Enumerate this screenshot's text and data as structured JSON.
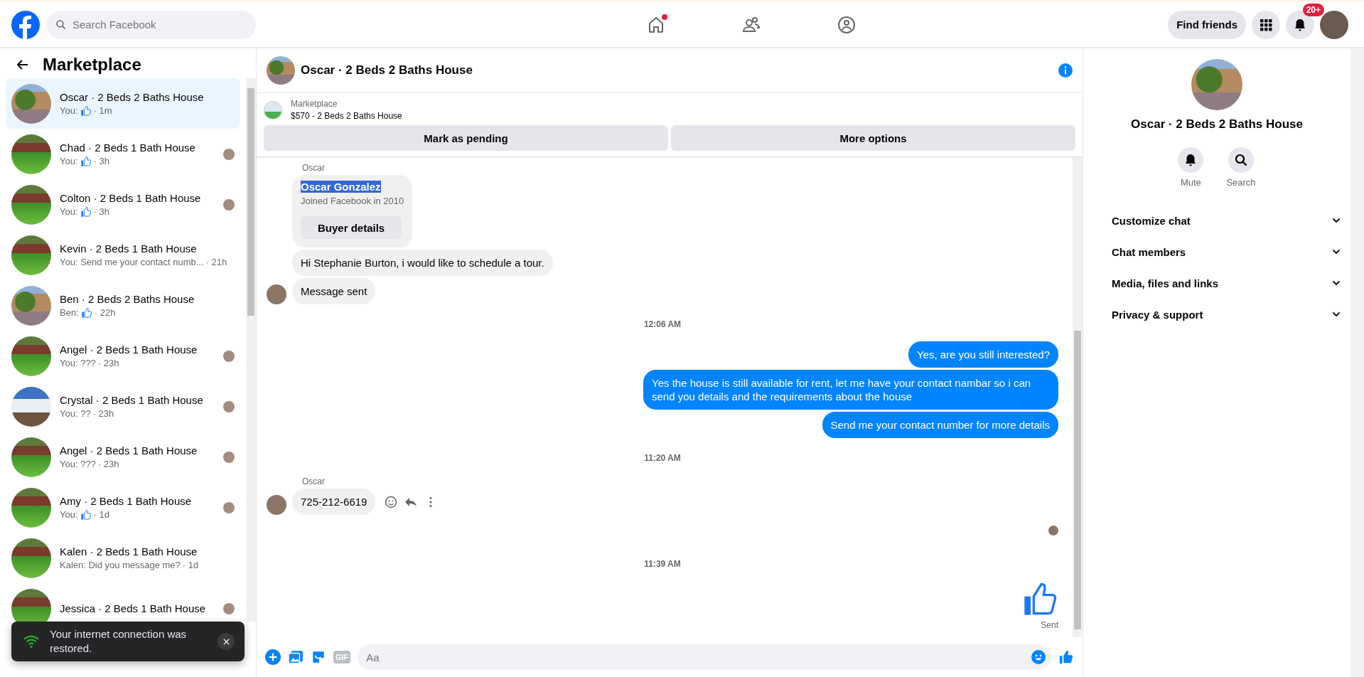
{
  "topbar": {
    "search": {
      "placeholder": "Search Facebook"
    },
    "nav": [
      {
        "kind": "home",
        "notification": true
      },
      {
        "kind": "friends",
        "notification": false
      },
      {
        "kind": "groups",
        "notification": false
      }
    ],
    "find_friends": "Find friends",
    "notifications_badge": "20+"
  },
  "sidebar": {
    "title": "Marketplace",
    "items": [
      {
        "title": "Oscar · 2 Beds 2 Baths House",
        "preview": "You:",
        "like": true,
        "time": "· 1m",
        "kind": "palm",
        "seen": false,
        "selected": true
      },
      {
        "title": "Chad · 2 Beds 1 Bath House",
        "preview": "You:",
        "like": true,
        "time": "· 3h",
        "kind": "lawn",
        "seen": true,
        "selected": false
      },
      {
        "title": "Colton · 2 Beds 1 Bath House",
        "preview": "You:",
        "like": true,
        "time": "· 3h",
        "kind": "lawn",
        "seen": true,
        "selected": false
      },
      {
        "title": "Kevin · 2 Beds 1 Bath House",
        "preview": "You: Send me your contact numb...",
        "like": false,
        "time": "· 21h",
        "kind": "lawn",
        "seen": false,
        "selected": false
      },
      {
        "title": "Ben · 2 Beds 2 Baths House",
        "preview": "Ben:",
        "like": true,
        "time": "· 22h",
        "kind": "palm",
        "seen": false,
        "selected": false
      },
      {
        "title": "Angel · 2 Beds 1 Bath House",
        "preview": "You: ???",
        "like": false,
        "time": "· 23h",
        "kind": "lawn",
        "seen": true,
        "selected": false
      },
      {
        "title": "Crystal · 2 Beds 1 Bath House",
        "preview": "You: ??",
        "like": false,
        "time": "· 23h",
        "kind": "white-house",
        "seen": true,
        "selected": false
      },
      {
        "title": "Angel · 2 Beds 1 Bath House",
        "preview": "You: ???",
        "like": false,
        "time": "· 23h",
        "kind": "lawn",
        "seen": true,
        "selected": false
      },
      {
        "title": "Amy · 2 Beds 1 Bath House",
        "preview": "You:",
        "like": true,
        "time": "· 1d",
        "kind": "lawn",
        "seen": true,
        "selected": false
      },
      {
        "title": "Kalen · 2 Beds 1 Bath House",
        "preview": "Kalen: Did you message me?",
        "like": false,
        "time": "· 1d",
        "kind": "lawn",
        "seen": false,
        "selected": false
      },
      {
        "title": "Jessica · 2 Beds 1 Bath House",
        "kind": "lawn",
        "seen": true,
        "selected": false
      }
    ]
  },
  "toast": {
    "text": "Your internet connection was restored."
  },
  "chat": {
    "title": "Oscar · 2 Beds 2 Baths House",
    "listing": {
      "label": "Marketplace",
      "price_title": "$570 - 2 Beds 2 Baths House"
    },
    "actions": [
      "Mark as pending",
      "More options"
    ],
    "messages": [
      {
        "kind": "sender",
        "text": "Oscar"
      },
      {
        "kind": "card",
        "name": "Oscar Gonzalez",
        "name_highlighted": true,
        "subtitle": "Joined Facebook in 2010",
        "button": "Buyer details"
      },
      {
        "kind": "incoming",
        "text": "Hi Stephanie Burton, i would like to schedule a tour.",
        "avatar": false,
        "tools": false
      },
      {
        "kind": "incoming",
        "text": "Message sent",
        "avatar": true,
        "tools": false
      },
      {
        "kind": "time",
        "text": "12:06 AM"
      },
      {
        "kind": "outgoing",
        "text": "Yes, are you still interested?"
      },
      {
        "kind": "outgoing",
        "text": "Yes the house is still available for rent, let me have your contact nambar so i can send you details and the requirements about the house"
      },
      {
        "kind": "outgoing",
        "text": "Send me your contact number for more details"
      },
      {
        "kind": "time",
        "text": "11:20 AM"
      },
      {
        "kind": "sender",
        "text": "Oscar"
      },
      {
        "kind": "incoming",
        "text": "725-212-6619",
        "avatar": true,
        "tools": true
      },
      {
        "kind": "seen"
      },
      {
        "kind": "time",
        "text": "11:39 AM"
      },
      {
        "kind": "like",
        "status": "Sent"
      }
    ],
    "composer": {
      "gif": "GIF",
      "placeholder": "Aa"
    }
  },
  "details": {
    "title": "Oscar · 2 Beds 2 Baths House",
    "actions": [
      {
        "kind": "mute",
        "label": "Mute"
      },
      {
        "kind": "search",
        "label": "Search"
      }
    ],
    "sections": [
      {
        "label": "Customize chat",
        "expanded": false
      },
      {
        "label": "Chat members",
        "expanded": false
      },
      {
        "label": "Media, files and links",
        "expanded": false
      },
      {
        "label": "Privacy & support",
        "expanded": false
      }
    ]
  }
}
